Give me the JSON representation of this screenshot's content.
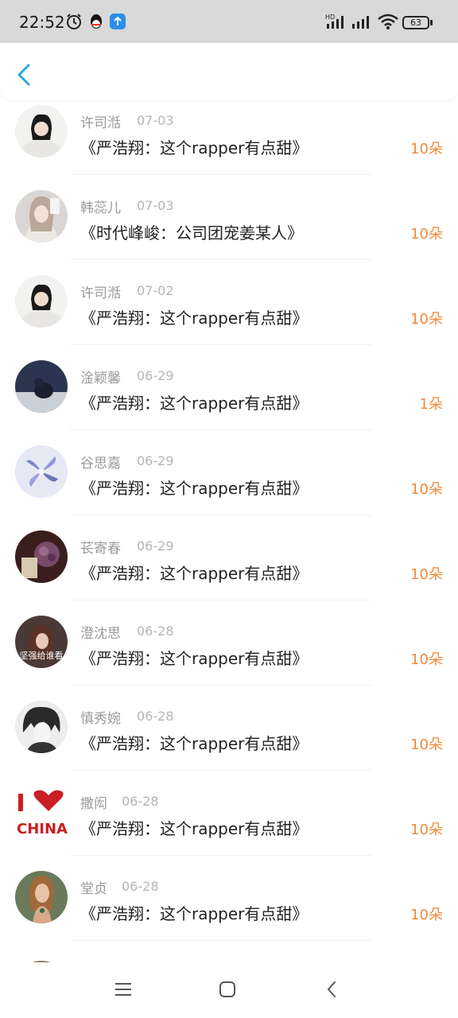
{
  "status_bar": {
    "time": "22:52",
    "battery": "63",
    "icons": [
      "alarm-icon",
      "qq-icon",
      "upload-icon",
      "hd-signal-icon",
      "signal-icon",
      "wifi-icon",
      "battery-icon"
    ]
  },
  "header": {
    "back_icon": "chevron-left-icon",
    "accent_color": "#2ea7e0"
  },
  "list": {
    "items": [
      {
        "name": "许司湉",
        "date": "07-03",
        "title": "《严浩翔：这个rapper有点甜》",
        "amount": "10朵"
      },
      {
        "name": "韩蕊儿",
        "date": "07-03",
        "title": "《时代峰峻：公司团宠姜某人》",
        "amount": "10朵"
      },
      {
        "name": "许司湉",
        "date": "07-02",
        "title": "《严浩翔：这个rapper有点甜》",
        "amount": "10朵"
      },
      {
        "name": "淦颖馨",
        "date": "06-29",
        "title": "《严浩翔：这个rapper有点甜》",
        "amount": "1朵"
      },
      {
        "name": "谷思嘉",
        "date": "06-29",
        "title": "《严浩翔：这个rapper有点甜》",
        "amount": "10朵"
      },
      {
        "name": "苌寄春",
        "date": "06-29",
        "title": "《严浩翔：这个rapper有点甜》",
        "amount": "10朵"
      },
      {
        "name": "澄沈思",
        "date": "06-28",
        "title": "《严浩翔：这个rapper有点甜》",
        "amount": "10朵"
      },
      {
        "name": "慎秀婉",
        "date": "06-28",
        "title": "《严浩翔：这个rapper有点甜》",
        "amount": "10朵"
      },
      {
        "name": "撒闳",
        "date": "06-28",
        "title": "《严浩翔：这个rapper有点甜》",
        "amount": "10朵"
      },
      {
        "name": "堂贞",
        "date": "06-28",
        "title": "《严浩翔：这个rapper有点甜》",
        "amount": "10朵"
      }
    ],
    "avatar_7_text": "坚强给谁看",
    "avatar_9_text": "CHINA",
    "amount_color": "#f08a3a"
  },
  "nav_bar": {
    "icons": [
      "menu-icon",
      "home-icon",
      "back-icon"
    ]
  }
}
